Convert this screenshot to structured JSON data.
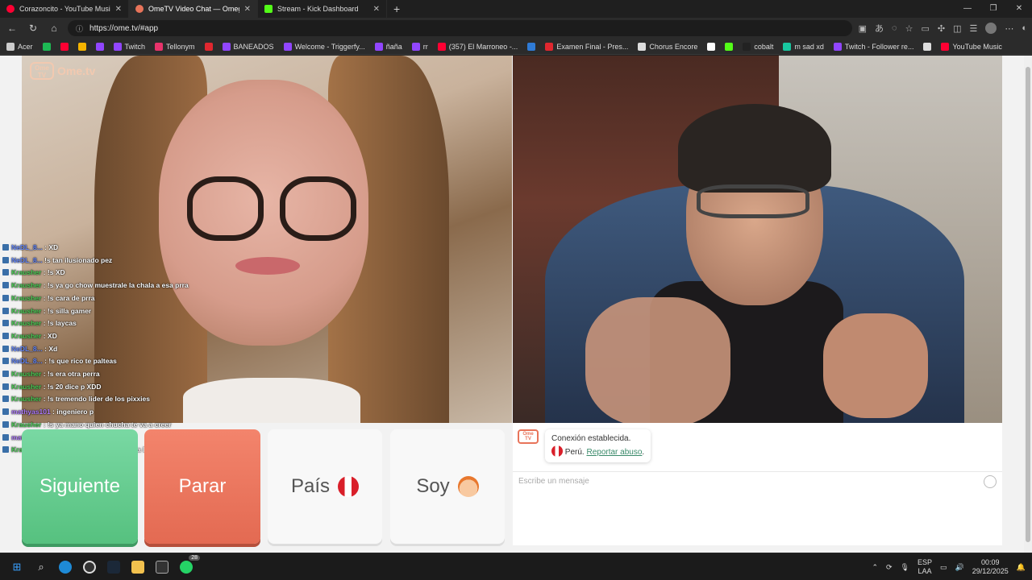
{
  "browser": {
    "tabs": [
      {
        "title": "Corazoncito - YouTube Music",
        "icon_color": "#ff0033",
        "active": false
      },
      {
        "title": "OmeTV Video Chat — Omegle",
        "icon_color": "#e8745a",
        "active": true
      },
      {
        "title": "Stream - Kick Dashboard",
        "icon_color": "#53fc18",
        "active": false
      }
    ],
    "new_tab_label": "+",
    "url": "https://ome.tv/#app",
    "bookmarks": [
      {
        "label": "Acer",
        "color": "#cccccc"
      },
      {
        "label": "",
        "color": "#1db954"
      },
      {
        "label": "",
        "color": "#ff0033"
      },
      {
        "label": "",
        "color": "#f5b400"
      },
      {
        "label": "",
        "color": "#9146ff"
      },
      {
        "label": "Twitch",
        "color": "#9146ff"
      },
      {
        "label": "Tellonym",
        "color": "#e8336b"
      },
      {
        "label": "",
        "color": "#e0272f"
      },
      {
        "label": "BANEADOS",
        "color": "#9146ff"
      },
      {
        "label": "Welcome - Triggerfy...",
        "color": "#9146ff"
      },
      {
        "label": "ñaña",
        "color": "#9146ff"
      },
      {
        "label": "rr",
        "color": "#9146ff"
      },
      {
        "label": "(357) El Marroneo -...",
        "color": "#ff0033"
      },
      {
        "label": "",
        "color": "#2f7bd6"
      },
      {
        "label": "Examen Final - Pres...",
        "color": "#e0272f"
      },
      {
        "label": "Chorus Encore",
        "color": "#dddddd"
      },
      {
        "label": "",
        "color": "#ffffff"
      },
      {
        "label": "",
        "color": "#53fc18"
      },
      {
        "label": "cobalt",
        "color": "#222222"
      },
      {
        "label": "m sad xd",
        "color": "#18c7a0"
      },
      {
        "label": "Twitch - Follower re...",
        "color": "#9146ff"
      },
      {
        "label": "",
        "color": "#dddddd"
      },
      {
        "label": "YouTube Music",
        "color": "#ff0033"
      }
    ]
  },
  "ometv": {
    "logo_box": "Ome TV",
    "logo_text": "Ome.tv",
    "chat_overlay": [
      {
        "user": "NeDL_8...",
        "msg": ": XD",
        "color": "#6a8cff"
      },
      {
        "user": "NeDL_8...",
        "msg": "!s tan ilusionado pez",
        "color": "#6a8cff"
      },
      {
        "user": "Krausher",
        "msg": ": !s XD",
        "color": "#4fd15a"
      },
      {
        "user": "Krausher",
        "msg": ": !s ya go chow muestrale la chala a esa prra",
        "color": "#4fd15a"
      },
      {
        "user": "Krausher",
        "msg": ": !s cara de prra",
        "color": "#4fd15a"
      },
      {
        "user": "Krausher",
        "msg": ": !s silla gamer",
        "color": "#4fd15a"
      },
      {
        "user": "Krausher",
        "msg": ": !s laycas",
        "color": "#4fd15a"
      },
      {
        "user": "Krausher",
        "msg": ": XD",
        "color": "#4fd15a"
      },
      {
        "user": "NeDL_8...",
        "msg": ": Xd",
        "color": "#6a8cff"
      },
      {
        "user": "NeDL_8...",
        "msg": ": !s que rico te palteas",
        "color": "#6a8cff"
      },
      {
        "user": "Krausher",
        "msg": ": !s era otra perra",
        "color": "#4fd15a"
      },
      {
        "user": "Krausher",
        "msg": ": !s 20 dice p XDD",
        "color": "#4fd15a"
      },
      {
        "user": "Krausher",
        "msg": ": !s tremendo lider de los pixxies",
        "color": "#4fd15a"
      },
      {
        "user": "mathyas101",
        "msg": ": ingeniero p",
        "color": "#b07cff"
      },
      {
        "user": "Krausher",
        "msg": ": !s ya mano quien chucha te va a creer",
        "color": "#4fd15a"
      },
      {
        "user": "mathyas101",
        "msg": ": de catar penes mn",
        "color": "#b07cff"
      },
      {
        "user": "Krausher",
        "msg": ": !s puro chatgpt para entrar a la uni p",
        "color": "#4fd15a"
      }
    ],
    "buttons": {
      "next": "Siguiente",
      "stop": "Parar",
      "country": "País",
      "gender": "Soy"
    },
    "system_message": {
      "line1": "Conexión establecida.",
      "country": "Perú.",
      "report": "Reportar abuso",
      "trail": "."
    },
    "message_placeholder": "Escribe un mensaje"
  },
  "taskbar": {
    "lang_top": "ESP",
    "lang_bottom": "LAA",
    "time": "00:09",
    "date": "29/12/2025",
    "badge_count": "28"
  }
}
